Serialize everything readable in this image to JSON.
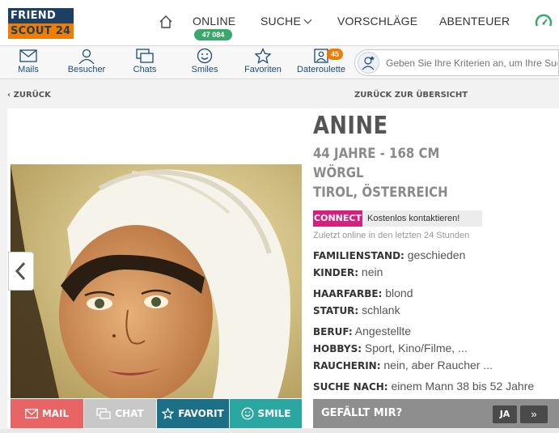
{
  "logo": {
    "line1": "FRIEND",
    "line2": "SCOUT 24"
  },
  "nav": {
    "online_label": "ONLINE",
    "online_count": "47 084",
    "search_label": "SUCHE",
    "suggestions_label": "VORSCHLÄGE",
    "adventure_label": "ABENTEUER"
  },
  "subnav": {
    "items": [
      {
        "label": "Mails",
        "icon": "mail-icon"
      },
      {
        "label": "Besucher",
        "icon": "visitor-icon"
      },
      {
        "label": "Chats",
        "icon": "chat-icon"
      },
      {
        "label": "Smiles",
        "icon": "smile-icon"
      },
      {
        "label": "Favoriten",
        "icon": "star-icon"
      },
      {
        "label": "Dateroulette",
        "icon": "dateroulette-icon"
      }
    ],
    "dateroulette_badge": "45",
    "search_placeholder": "Geben Sie Ihre Kriterien an, um Ihre Suche zu starten"
  },
  "backbar": {
    "back_label": "ZURÜCK",
    "overview_label": "ZURÜCK ZUR ÜBERSICHT"
  },
  "profile": {
    "name": "ANINE",
    "age_height": "44 JAHRE - 168 CM",
    "city": "WÖRGL",
    "region": "TIROL, ÖSTERREICH",
    "connect_tag": "CONNECT",
    "connect_cta": "Kostenlos kontaktieren!",
    "last_online": "Zuletzt online in den letzten 24 Stunden",
    "attributes": [
      {
        "key": "FAMILIENSTAND:",
        "value": "geschieden"
      },
      {
        "key": "KINDER:",
        "value": "nein"
      },
      {
        "key": "HAARFARBE:",
        "value": "blond"
      },
      {
        "key": "STATUR:",
        "value": "schlank"
      },
      {
        "key": "BERUF:",
        "value": "Angestellte"
      },
      {
        "key": "HOBBYS:",
        "value": "Sport, Kino/Filme, ..."
      },
      {
        "key": "RAUCHERIN:",
        "value": "nein, aber Raucher ..."
      },
      {
        "key": "SUCHE NACH:",
        "value": "einem Mann 38 bis 52 Jahre"
      }
    ]
  },
  "actions": {
    "mail": "MAIL",
    "chat": "CHAT",
    "favorit": "FAVORIT",
    "smile": "SMILE"
  },
  "like": {
    "label": "GEFÄLLT MIR?",
    "yes": "JA",
    "next": "»"
  },
  "colors": {
    "brand_navy": "#1c3f63",
    "brand_orange": "#f07d00",
    "online_green": "#3aa86b",
    "mail_red": "#e96465",
    "chat_gray": "#c8c8c8",
    "favorit_teal": "#1b6f87",
    "smile_teal": "#2aa7a0",
    "connect_pink": "#d61f7e"
  }
}
